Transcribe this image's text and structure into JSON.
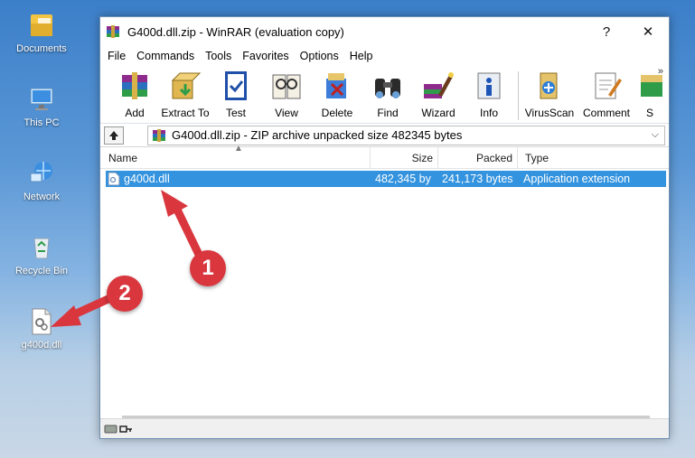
{
  "desktop": {
    "icons": [
      {
        "label": "Documents",
        "icon": "folder-icon"
      },
      {
        "label": "This PC",
        "icon": "computer-icon"
      },
      {
        "label": "Network",
        "icon": "network-icon"
      },
      {
        "label": "Recycle Bin",
        "icon": "recycle-bin-icon"
      },
      {
        "label": "g400d.dll",
        "icon": "dll-file-icon"
      }
    ]
  },
  "window": {
    "title": "G400d.dll.zip - WinRAR (evaluation copy)",
    "controls": {
      "help": "?",
      "close": "✕"
    }
  },
  "menu": [
    "File",
    "Commands",
    "Tools",
    "Favorites",
    "Options",
    "Help"
  ],
  "toolbar": {
    "buttons": [
      {
        "label": "Add",
        "icon": "add-archive-icon"
      },
      {
        "label": "Extract To",
        "icon": "extract-icon"
      },
      {
        "label": "Test",
        "icon": "test-icon"
      },
      {
        "label": "View",
        "icon": "view-icon"
      },
      {
        "label": "Delete",
        "icon": "delete-icon"
      },
      {
        "label": "Find",
        "icon": "find-icon"
      },
      {
        "label": "Wizard",
        "icon": "wizard-icon"
      },
      {
        "label": "Info",
        "icon": "info-icon"
      },
      {
        "label": "VirusScan",
        "icon": "virusscan-icon"
      },
      {
        "label": "Comment",
        "icon": "comment-icon"
      },
      {
        "label": "S",
        "icon": "sfx-icon"
      }
    ],
    "more": "»"
  },
  "address": {
    "text": "G400d.dll.zip - ZIP archive unpacked size 482345 bytes",
    "dropdown": "⌵"
  },
  "columns": {
    "name": "Name",
    "size": "Size",
    "packed": "Packed",
    "type": "Type"
  },
  "files": [
    {
      "name": "g400d.dll",
      "size": "482,345 by",
      "packed": "241,173 bytes",
      "type": "Application extension"
    }
  ],
  "annotations": {
    "badge1": "1",
    "badge2": "2"
  },
  "colors": {
    "selection": "#3393df",
    "badge": "#d9363e",
    "arrow": "#d9363e"
  }
}
